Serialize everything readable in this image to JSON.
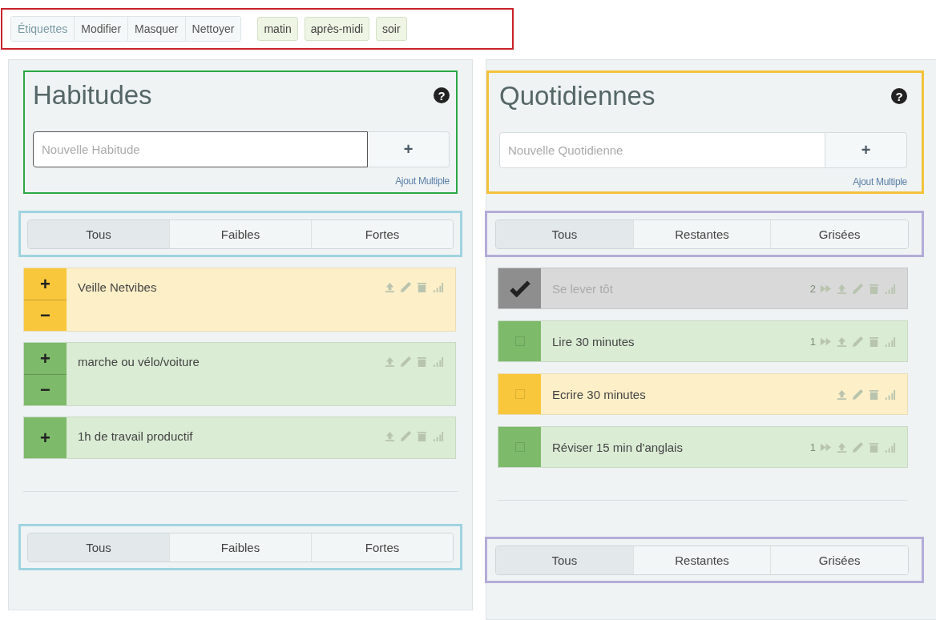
{
  "toolbar": {
    "buttons": [
      {
        "label": "Étiquettes",
        "selected": true
      },
      {
        "label": "Modifier",
        "selected": false
      },
      {
        "label": "Masquer",
        "selected": false
      },
      {
        "label": "Nettoyer",
        "selected": false
      }
    ],
    "tags": [
      "matin",
      "après-midi",
      "soir"
    ]
  },
  "columns": [
    {
      "kind": "habits",
      "title": "Habitudes",
      "help": "?",
      "input": {
        "placeholder": "Nouvelle Habitude"
      },
      "add_button": "+",
      "bulk_link": "Ajout Multiple",
      "filters": [
        {
          "label": "Tous",
          "selected": true
        },
        {
          "label": "Faibles",
          "selected": false
        },
        {
          "label": "Fortes",
          "selected": false
        }
      ],
      "items": [
        {
          "text": "Veille Netvibes",
          "color": "#f9c73b",
          "up": "+",
          "down": "−"
        },
        {
          "text": "marche ou vélo/voiture",
          "color": "#7dba6a",
          "up": "+",
          "down": "−"
        },
        {
          "text": "1h de travail productif",
          "color": "#7dba6a",
          "up": "+"
        }
      ],
      "bottom_filters": [
        {
          "label": "Tous",
          "selected": true
        },
        {
          "label": "Faibles",
          "selected": false
        },
        {
          "label": "Fortes",
          "selected": false
        }
      ]
    },
    {
      "kind": "dailies",
      "title": "Quotidiennes",
      "help": "?",
      "input": {
        "placeholder": "Nouvelle Quotidienne"
      },
      "add_button": "+",
      "bulk_link": "Ajout Multiple",
      "filters": [
        {
          "label": "Tous",
          "selected": true
        },
        {
          "label": "Restantes",
          "selected": false
        },
        {
          "label": "Grisées",
          "selected": false
        }
      ],
      "items": [
        {
          "text": "Se lever tôt",
          "checked": true,
          "streak": "2"
        },
        {
          "text": "Lire 30 minutes",
          "checked": false,
          "color": "#7dba6a",
          "streak": "1"
        },
        {
          "text": "Ecrire 30 minutes",
          "checked": false,
          "color": "#f9c73b"
        },
        {
          "text": "Réviser 15 min d'anglais",
          "checked": false,
          "color": "#7dba6a",
          "streak": "1"
        }
      ],
      "bottom_filters": [
        {
          "label": "Tous",
          "selected": true
        },
        {
          "label": "Restantes",
          "selected": false
        },
        {
          "label": "Grisées",
          "selected": false
        }
      ]
    }
  ]
}
